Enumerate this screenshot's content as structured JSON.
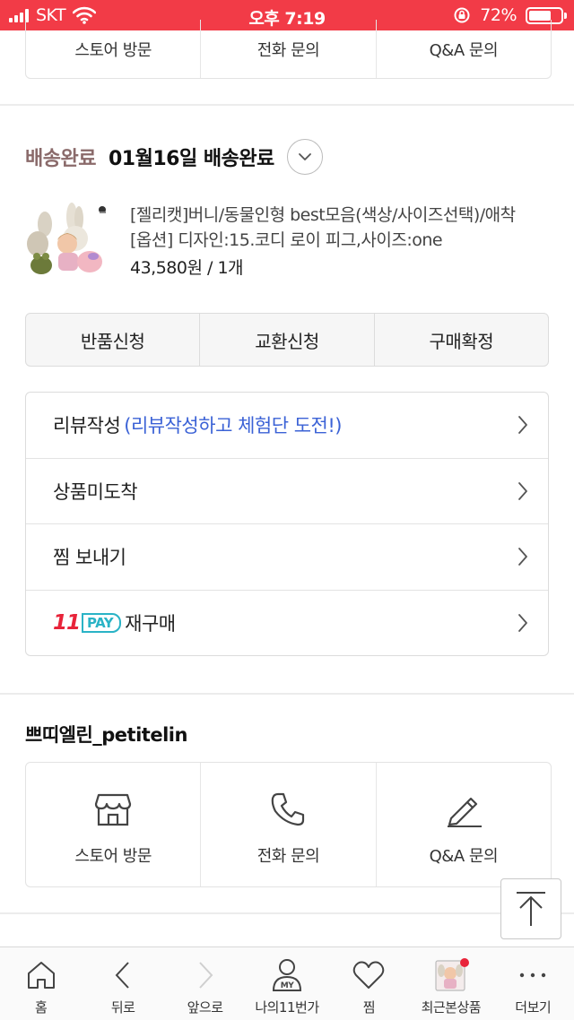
{
  "status_bar": {
    "carrier": "SKT",
    "time": "오후 7:19",
    "battery": "72%",
    "battery_level": 0.72
  },
  "contact_top": {
    "items": [
      "스토어 방문",
      "전화 문의",
      "Q&A 문의"
    ]
  },
  "delivery": {
    "status": "배송완료",
    "date_text": "01월16일 배송완료"
  },
  "product": {
    "name": "[젤리캣]버니/동물인형 best모음(색상/사이즈선택)/애착",
    "option": "[옵션] 디자인:15.코디 로이 피그,사이즈:one",
    "price": "43,580원 / 1개"
  },
  "actions": [
    "반품신청",
    "교환신청",
    "구매확정"
  ],
  "list": {
    "review_label": "리뷰작성",
    "review_hint": "(리뷰작성하고 체험단 도전!)",
    "not_arrived": "상품미도착",
    "send_wish": "찜 보내기",
    "pay_11": "11",
    "pay_word": "PAY",
    "rebuy": "재구매"
  },
  "seller": {
    "name": "쁘띠엘린_petitelin",
    "store": "스토어 방문",
    "phone": "전화 문의",
    "qna": "Q&A 문의"
  },
  "bottom_nav": [
    {
      "label": "홈",
      "icon": "home-icon"
    },
    {
      "label": "뒤로",
      "icon": "back-icon"
    },
    {
      "label": "앞으로",
      "icon": "forward-icon"
    },
    {
      "label": "나의11번가",
      "icon": "my-icon"
    },
    {
      "label": "찜",
      "icon": "heart-icon"
    },
    {
      "label": "최근본상품",
      "icon": "recent-icon"
    },
    {
      "label": "더보기",
      "icon": "more-icon"
    }
  ],
  "my_icon_text": "MY",
  "colors": {
    "status_bar": "#f23b47",
    "delivery_status": "#8a6a6a",
    "review_hint": "#3b62d6",
    "pay_red": "#e8243a",
    "pay_teal": "#2ab3c6"
  }
}
